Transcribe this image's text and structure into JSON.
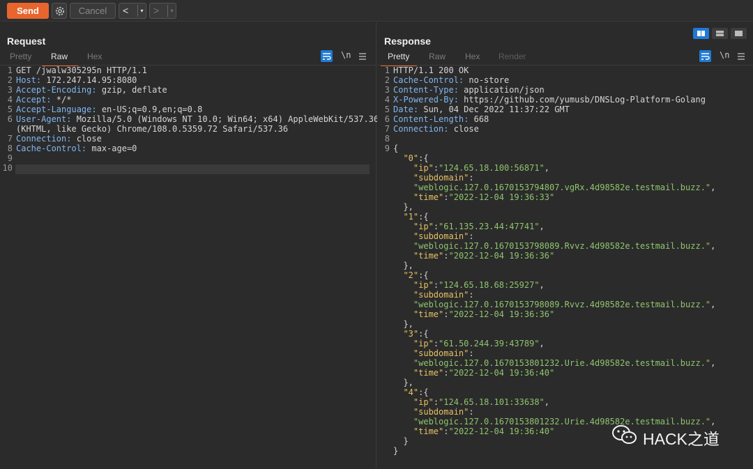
{
  "toolbar": {
    "send_label": "Send",
    "cancel_label": "Cancel",
    "prev_label": "<",
    "next_label": ">",
    "dropdown_glyph": "▾"
  },
  "request": {
    "title": "Request",
    "tabs": [
      "Pretty",
      "Raw",
      "Hex"
    ],
    "active_tab": "Raw",
    "newline_label": "\\n",
    "lines": [
      {
        "n": "1",
        "key": "",
        "val": "GET /jwalw305295n HTTP/1.1"
      },
      {
        "n": "2",
        "key": "Host:",
        "val": " 172.247.14.95:8080"
      },
      {
        "n": "3",
        "key": "Accept-Encoding:",
        "val": " gzip, deflate"
      },
      {
        "n": "4",
        "key": "Accept:",
        "val": " */*"
      },
      {
        "n": "5",
        "key": "Accept-Language:",
        "val": " en-US;q=0.9,en;q=0.8"
      },
      {
        "n": "6",
        "key": "User-Agent:",
        "val": " Mozilla/5.0 (Windows NT 10.0; Win64; x64) AppleWebKit/537.36"
      },
      {
        "n": "",
        "key": "",
        "val": "(KHTML, like Gecko) Chrome/108.0.5359.72 Safari/537.36"
      },
      {
        "n": "7",
        "key": "Connection:",
        "val": " close"
      },
      {
        "n": "8",
        "key": "Cache-Control:",
        "val": " max-age=0"
      },
      {
        "n": "9",
        "key": "",
        "val": ""
      },
      {
        "n": "10",
        "key": "",
        "val": ""
      }
    ]
  },
  "response": {
    "title": "Response",
    "tabs": [
      "Pretty",
      "Raw",
      "Hex",
      "Render"
    ],
    "active_tab": "Pretty",
    "newline_label": "\\n",
    "header_lines": [
      {
        "n": "1",
        "key": "",
        "val": "HTTP/1.1 200 OK"
      },
      {
        "n": "2",
        "key": "Cache-Control:",
        "val": " no-store"
      },
      {
        "n": "3",
        "key": "Content-Type:",
        "val": " application/json"
      },
      {
        "n": "4",
        "key": "X-Powered-By:",
        "val": " https://github.com/yumusb/DNSLog-Platform-Golang"
      },
      {
        "n": "5",
        "key": "Date:",
        "val": " Sun, 04 Dec 2022 11:37:22 GMT"
      },
      {
        "n": "6",
        "key": "Content-Length:",
        "val": " 668"
      },
      {
        "n": "7",
        "key": "Connection:",
        "val": " close"
      },
      {
        "n": "8",
        "key": "",
        "val": ""
      }
    ],
    "body_line_number": "9",
    "records": [
      {
        "id": "\"0\"",
        "ip": "\"124.65.18.100:56871\"",
        "subdomain": "\"weblogic.127.0.1670153794807.vgRx.4d98582e.testmail.buzz.\"",
        "time": "\"2022-12-04 19:36:33\""
      },
      {
        "id": "\"1\"",
        "ip": "\"61.135.23.44:47741\"",
        "subdomain": "\"weblogic.127.0.1670153798089.Rvvz.4d98582e.testmail.buzz.\"",
        "time": "\"2022-12-04 19:36:36\""
      },
      {
        "id": "\"2\"",
        "ip": "\"124.65.18.68:25927\"",
        "subdomain": "\"weblogic.127.0.1670153798089.Rvvz.4d98582e.testmail.buzz.\"",
        "time": "\"2022-12-04 19:36:36\""
      },
      {
        "id": "\"3\"",
        "ip": "\"61.50.244.39:43789\"",
        "subdomain": "\"weblogic.127.0.1670153801232.Urie.4d98582e.testmail.buzz.\"",
        "time": "\"2022-12-04 19:36:40\""
      },
      {
        "id": "\"4\"",
        "ip": "\"124.65.18.101:33638\"",
        "subdomain": "\"weblogic.127.0.1670153801232.Urie.4d98582e.testmail.buzz.\"",
        "time": "\"2022-12-04 19:36:40\""
      }
    ],
    "keys": {
      "ip": "\"ip\"",
      "subdomain": "\"subdomain\"",
      "time": "\"time\""
    }
  },
  "watermark": {
    "text": "HACK之道"
  },
  "colors": {
    "accent": "#e8652e",
    "header_key": "#82b6ee",
    "json_key": "#e6c264",
    "json_string": "#8fc46d",
    "toggle_active": "#1f7ad6"
  },
  "icons": [
    "settings-gear-icon",
    "word-wrap-icon",
    "menu-icon",
    "wechat-logo-icon",
    "split-horizontal-icon",
    "split-vertical-icon",
    "single-panel-icon"
  ]
}
